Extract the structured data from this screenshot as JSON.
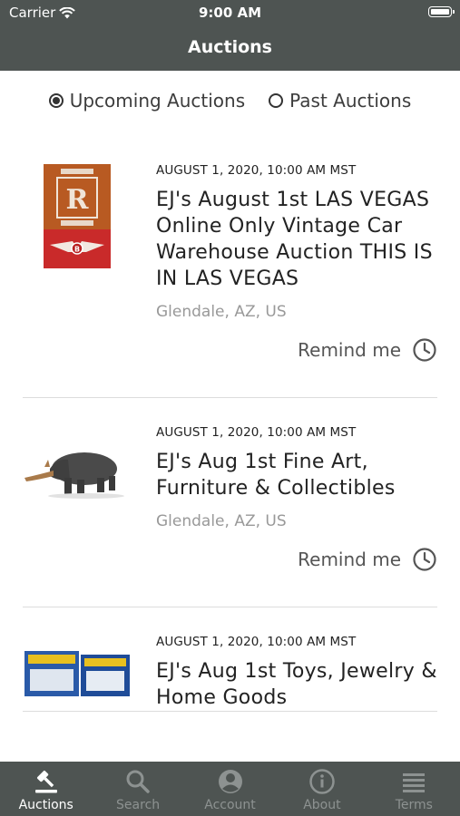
{
  "status_bar": {
    "carrier": "Carrier",
    "time": "9:00 AM"
  },
  "nav": {
    "title": "Auctions"
  },
  "filter": {
    "options": [
      {
        "label": "Upcoming Auctions",
        "selected": true
      },
      {
        "label": "Past Auctions",
        "selected": false
      }
    ]
  },
  "auctions": [
    {
      "date": "AUGUST 1, 2020, 10:00 AM MST",
      "title": "EJ's August 1st LAS VEGAS Online Only Vintage Car Warehouse Auction THIS IS IN LAS VEGAS",
      "location": "Glendale, AZ, US",
      "remind_label": "Remind me",
      "image": "rolls-royce-flag-thumbnail"
    },
    {
      "date": "AUGUST 1, 2020, 10:00 AM MST",
      "title": "EJ's Aug 1st Fine Art, Furniture & Collectibles",
      "location": "Glendale, AZ, US",
      "remind_label": "Remind me",
      "image": "rhino-sculpture-thumbnail"
    },
    {
      "date": "AUGUST 1, 2020, 10:00 AM MST",
      "title": "EJ's Aug 1st Toys, Jewelry & Home Goods",
      "location": "",
      "remind_label": "",
      "image": "star-wars-toys-thumbnail"
    }
  ],
  "tabs": [
    {
      "label": "Auctions",
      "icon": "gavel-icon",
      "active": true
    },
    {
      "label": "Search",
      "icon": "search-icon",
      "active": false
    },
    {
      "label": "Account",
      "icon": "account-icon",
      "active": false
    },
    {
      "label": "About",
      "icon": "info-icon",
      "active": false
    },
    {
      "label": "Terms",
      "icon": "terms-icon",
      "active": false
    }
  ],
  "colors": {
    "bar": "#4e5452",
    "tab_active": "#ffffff",
    "tab_inactive": "#8d9291"
  }
}
